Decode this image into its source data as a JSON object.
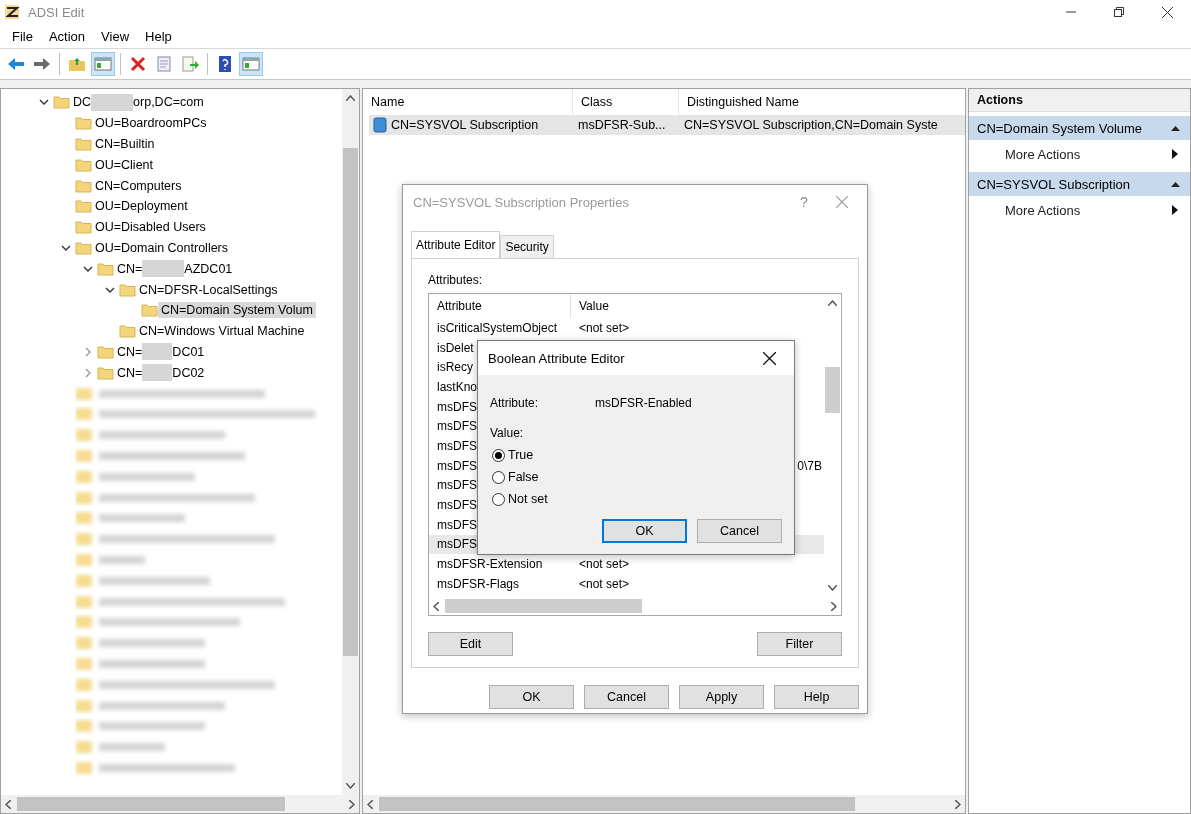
{
  "window": {
    "title": "ADSI Edit"
  },
  "menu": [
    "File",
    "Action",
    "View",
    "Help"
  ],
  "toolbar": [
    {
      "kind": "back",
      "pressed": false
    },
    {
      "kind": "forward",
      "pressed": false
    },
    {
      "kind": "sep"
    },
    {
      "kind": "up",
      "pressed": false
    },
    {
      "kind": "tree",
      "pressed": true
    },
    {
      "kind": "sep"
    },
    {
      "kind": "delete",
      "pressed": false
    },
    {
      "kind": "properties",
      "pressed": false
    },
    {
      "kind": "export",
      "pressed": false
    },
    {
      "kind": "sep"
    },
    {
      "kind": "help",
      "pressed": false
    },
    {
      "kind": "pane",
      "pressed": true
    }
  ],
  "tree": [
    {
      "kind": "redacted",
      "prefix": "DC",
      "suffix": "orp,DC=com",
      "expanded": true,
      "selected": false,
      "children": [
        {
          "kind": "text",
          "label": "OU=BoardroomPCs",
          "selected": false
        },
        {
          "kind": "text",
          "label": "CN=Builtin",
          "selected": false
        },
        {
          "kind": "text",
          "label": "OU=Client",
          "selected": false
        },
        {
          "kind": "text",
          "label": "CN=Computers",
          "selected": false
        },
        {
          "kind": "text",
          "label": "OU=Deployment",
          "selected": false
        },
        {
          "kind": "text",
          "label": "OU=Disabled Users",
          "selected": false
        },
        {
          "kind": "text",
          "label": "OU=Domain Controllers",
          "expanded": true,
          "selected": false,
          "children": [
            {
              "kind": "redacted",
              "prefix": "CN=",
              "suffix": "AZDC01",
              "expanded": true,
              "selected": false,
              "children": [
                {
                  "kind": "text",
                  "label": "CN=DFSR-LocalSettings",
                  "expanded": true,
                  "selected": false,
                  "children": [
                    {
                      "kind": "text",
                      "label": "CN=Domain System Volum",
                      "selected": true
                    }
                  ]
                },
                {
                  "kind": "text",
                  "label": "CN=Windows Virtual Machine",
                  "selected": false
                }
              ]
            },
            {
              "kind": "redacted",
              "prefix": "CN=",
              "suffix": "DC01",
              "expanded": false,
              "selected": false
            },
            {
              "kind": "redacted",
              "prefix": "CN=",
              "suffix": "DC02",
              "expanded": false,
              "selected": false
            }
          ]
        },
        {
          "kind": "blurred"
        },
        {
          "kind": "blurred"
        },
        {
          "kind": "blurred"
        },
        {
          "kind": "blurred"
        },
        {
          "kind": "blurred"
        },
        {
          "kind": "blurred"
        },
        {
          "kind": "blurred"
        },
        {
          "kind": "blurred"
        },
        {
          "kind": "blurred"
        },
        {
          "kind": "blurred"
        },
        {
          "kind": "blurred"
        },
        {
          "kind": "blurred"
        },
        {
          "kind": "blurred"
        },
        {
          "kind": "blurred"
        },
        {
          "kind": "blurred"
        },
        {
          "kind": "blurred"
        },
        {
          "kind": "blurred"
        },
        {
          "kind": "blurred"
        },
        {
          "kind": "blurred"
        }
      ]
    }
  ],
  "list": {
    "columns": [
      "Name",
      "Class",
      "Distinguished Name"
    ],
    "rows": [
      {
        "cells": [
          "CN=SYSVOL Subscription",
          "msDFSR-Sub...",
          "CN=SYSVOL Subscription,CN=Domain Syste"
        ],
        "selected": true
      }
    ]
  },
  "actions": {
    "title": "Actions",
    "groups": [
      {
        "title": "CN=Domain System Volume",
        "expanded": true,
        "items": [
          "More Actions"
        ]
      },
      {
        "title": "CN=SYSVOL Subscription",
        "expanded": true,
        "items": [
          "More Actions"
        ]
      }
    ]
  },
  "properties_dialog": {
    "title": "CN=SYSVOL Subscription Properties",
    "help": "?",
    "tabs": [
      {
        "label": "Attribute Editor",
        "selected": true
      },
      {
        "label": "Security",
        "selected": false
      }
    ],
    "attributes_label": "Attributes:",
    "columns": [
      "Attribute",
      "Value"
    ],
    "rows": [
      {
        "attribute": "isCriticalSystemObject",
        "value": "<not set>",
        "selected": false
      },
      {
        "attribute": "isDelet",
        "selected": false
      },
      {
        "attribute": "isRecy",
        "selected": false
      },
      {
        "attribute": "lastKno",
        "selected": false
      },
      {
        "attribute": "msDFS",
        "selected": false
      },
      {
        "attribute": "msDFS",
        "selected": false
      },
      {
        "attribute": "msDFS",
        "selected": false
      },
      {
        "attribute": "msDFS",
        "value_tail": "0\\7B",
        "selected": false
      },
      {
        "attribute": "msDFS",
        "selected": false
      },
      {
        "attribute": "msDFS",
        "selected": false
      },
      {
        "attribute": "msDFS",
        "selected": false
      },
      {
        "attribute": "msDFS",
        "selected": true
      },
      {
        "attribute": "msDFSR-Extension",
        "value": "<not set>",
        "selected": false
      },
      {
        "attribute": "msDFSR-Flags",
        "value": "<not set>",
        "selected": false
      }
    ],
    "list_buttons": [
      "Edit",
      "Filter"
    ],
    "buttons": [
      "OK",
      "Cancel",
      "Apply",
      "Help"
    ]
  },
  "boolean_editor": {
    "title": "Boolean Attribute Editor",
    "attribute_label": "Attribute:",
    "attribute": "msDFSR-Enabled",
    "value_label": "Value:",
    "options": [
      {
        "label": "True",
        "selected": true
      },
      {
        "label": "False",
        "selected": false
      },
      {
        "label": "Not set",
        "selected": false
      }
    ],
    "buttons": [
      {
        "label": "OK",
        "default": true
      },
      {
        "label": "Cancel",
        "default": false
      }
    ]
  }
}
